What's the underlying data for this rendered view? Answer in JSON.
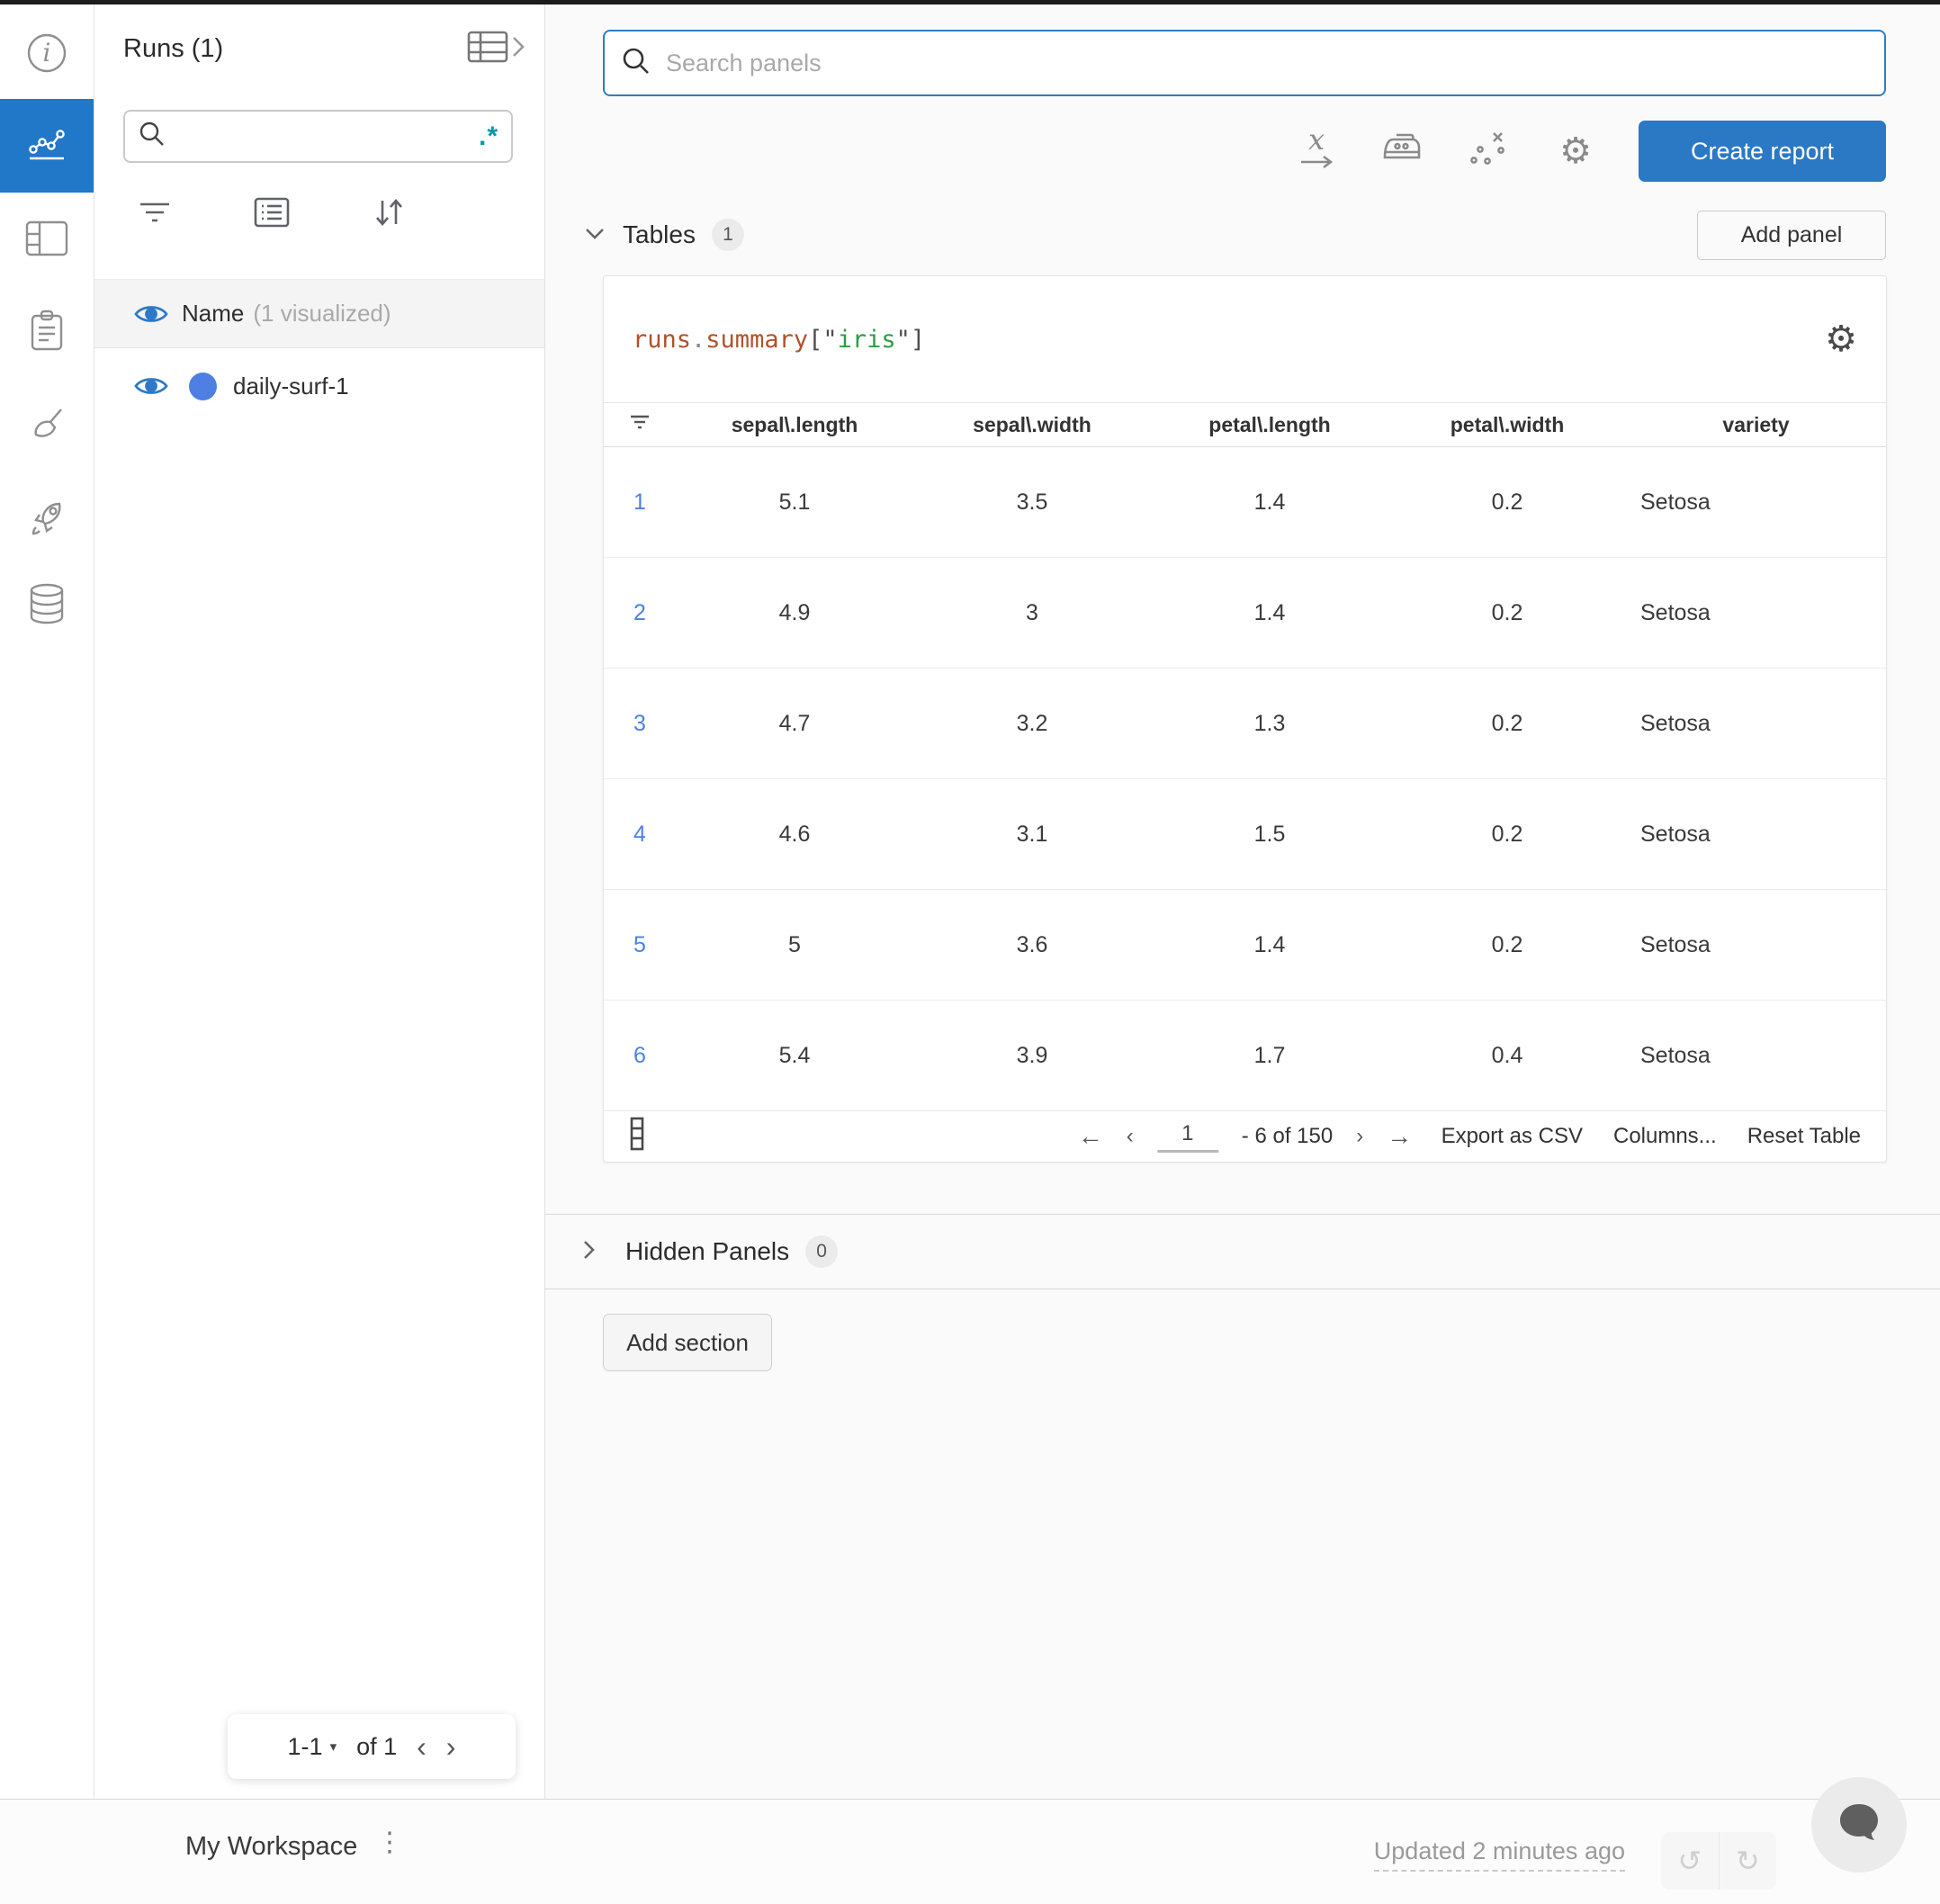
{
  "colors": {
    "accent_blue": "#2b78c5",
    "rail_active_bg": "#2177c8",
    "run_dot": "#4e80e4",
    "eye_blue": "#2e78c7",
    "row_number_blue": "#4a80e8",
    "regex_teal": "#0097ab",
    "code_object": "#b0522c",
    "code_string": "#2a9d44"
  },
  "icons": {
    "regex": ".*",
    "caret_down": "▾",
    "arrow_left": "←",
    "arrow_right": "→",
    "chevron_left": "‹",
    "chevron_right": "›",
    "gear": "⚙",
    "undo": "↺",
    "redo": "↻",
    "kebab": "⋮"
  },
  "runs_panel": {
    "title": "Runs (1)",
    "search_value": "",
    "header": {
      "name": "Name",
      "visualized": "(1 visualized)"
    },
    "runs": [
      {
        "name": "daily-surf-1"
      }
    ],
    "pagination": {
      "range": "1-1",
      "of": "of 1"
    }
  },
  "main": {
    "search_placeholder": "Search panels",
    "create_report_label": "Create report",
    "tables_section": {
      "label": "Tables",
      "count": "1",
      "add_panel_label": "Add panel"
    },
    "hidden_section": {
      "label": "Hidden Panels",
      "count": "0"
    },
    "add_section_label": "Add section",
    "panel": {
      "code": {
        "obj": "runs",
        "dot": ".",
        "attr": "summary",
        "open": "[",
        "q1": "\"",
        "key": "iris",
        "q2": "\"",
        "close": "]"
      },
      "table": {
        "headers": [
          "sepal\\.length",
          "sepal\\.width",
          "petal\\.length",
          "petal\\.width",
          "variety"
        ],
        "rows": [
          {
            "num": "1",
            "cells": [
              "5.1",
              "3.5",
              "1.4",
              "0.2",
              "Setosa"
            ]
          },
          {
            "num": "2",
            "cells": [
              "4.9",
              "3",
              "1.4",
              "0.2",
              "Setosa"
            ]
          },
          {
            "num": "3",
            "cells": [
              "4.7",
              "3.2",
              "1.3",
              "0.2",
              "Setosa"
            ]
          },
          {
            "num": "4",
            "cells": [
              "4.6",
              "3.1",
              "1.5",
              "0.2",
              "Setosa"
            ]
          },
          {
            "num": "5",
            "cells": [
              "5",
              "3.6",
              "1.4",
              "0.2",
              "Setosa"
            ]
          },
          {
            "num": "6",
            "cells": [
              "5.4",
              "3.9",
              "1.7",
              "0.4",
              "Setosa"
            ]
          }
        ]
      },
      "pagination": {
        "page": "1",
        "range_suffix": "- 6 of 150",
        "export_label": "Export as CSV",
        "columns_label": "Columns...",
        "reset_label": "Reset Table"
      }
    }
  },
  "footer": {
    "workspace_label": "My Workspace",
    "updated_label": "Updated 2 minutes ago"
  }
}
